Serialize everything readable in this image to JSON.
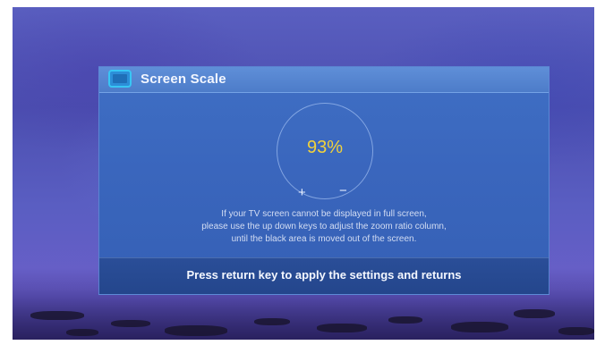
{
  "dialog": {
    "title": "Screen Scale",
    "icon": "screen-icon",
    "scale_value": "93%",
    "plus_label": "+",
    "minus_label": "−",
    "help_lines": [
      "If your TV screen cannot be displayed in full screen,",
      "please use the up down keys to adjust the zoom ratio column,",
      "until the black area is moved out of the screen."
    ],
    "footer_text": "Press return key to apply the settings and returns"
  },
  "colors": {
    "value_color": "#f2d23a",
    "icon_accent": "#38c6f4",
    "panel_background": "#3a66bd"
  }
}
